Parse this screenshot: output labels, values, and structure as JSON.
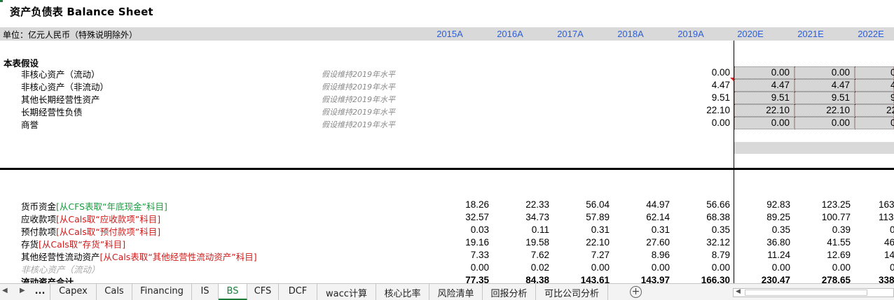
{
  "sheet": {
    "title": "资产负债表 Balance Sheet",
    "unit_label": "单位：亿元人民币（特殊说明除外）",
    "years": [
      "2015A",
      "2016A",
      "2017A",
      "2018A",
      "2019A",
      "2020E",
      "2021E",
      "2022E"
    ],
    "assumptions": {
      "heading": "本表假设",
      "rows": [
        {
          "label": "非核心资产（流动）",
          "note": "假设维持2019年水平",
          "v2019": "0.00",
          "v2020": "0.00",
          "v2021": "0.00",
          "v2022": "0"
        },
        {
          "label": "非核心资产（非流动）",
          "note": "假设维持2019年水平",
          "v2019": "4.47",
          "v2020": "4.47",
          "v2021": "4.47",
          "v2022": "4"
        },
        {
          "label": "其他长期经营性资产",
          "note": "假设维持2019年水平",
          "v2019": "9.51",
          "v2020": "9.51",
          "v2021": "9.51",
          "v2022": "9"
        },
        {
          "label": "长期经营性负债",
          "note": "假设维持2019年水平",
          "v2019": "22.10",
          "v2020": "22.10",
          "v2021": "22.10",
          "v2022": "22"
        },
        {
          "label": "商誉",
          "note": "假设维持2019年水平",
          "v2019": "0.00",
          "v2020": "0.00",
          "v2021": "0.00",
          "v2022": "0"
        }
      ]
    },
    "balance_rows": [
      {
        "label": "货币资金",
        "source": "[从CFS表取“年底现金”科目]",
        "source_color": "green",
        "values": [
          "18.26",
          "22.33",
          "56.04",
          "44.97",
          "56.66",
          "92.83",
          "123.25",
          "163"
        ]
      },
      {
        "label": "应收款项",
        "source": "[从Cals取“应收款项”科目]",
        "source_color": "red",
        "values": [
          "32.57",
          "34.73",
          "57.89",
          "62.14",
          "68.38",
          "89.25",
          "100.77",
          "113"
        ]
      },
      {
        "label": "预付款项",
        "source": "[从Cals取“预付款项”科目]",
        "source_color": "red",
        "values": [
          "0.03",
          "0.11",
          "0.31",
          "0.31",
          "0.35",
          "0.35",
          "0.39",
          "0"
        ]
      },
      {
        "label": "存货",
        "source": "[从Cals取“存货”科目]",
        "source_color": "red",
        "values": [
          "19.16",
          "19.58",
          "22.10",
          "27.60",
          "32.12",
          "36.80",
          "41.55",
          "46"
        ]
      },
      {
        "label": "其他经营性流动资产",
        "source": "[从Cals表取“其他经营性流动资产”科目]",
        "source_color": "red",
        "values": [
          "7.33",
          "7.62",
          "7.27",
          "8.96",
          "8.79",
          "11.24",
          "12.69",
          "14"
        ]
      },
      {
        "label": "非核心资产（流动）",
        "source": "",
        "source_color": "",
        "values": [
          "0.00",
          "0.02",
          "0.00",
          "0.00",
          "0.00",
          "0.00",
          "0.00",
          "0"
        ]
      },
      {
        "label": "流动资产合计",
        "source": "",
        "source_color": "",
        "values": [
          "77.35",
          "84.38",
          "143.61",
          "143.97",
          "166.30",
          "230.47",
          "278.65",
          "338"
        ]
      }
    ]
  },
  "tabs": {
    "ellipsis": "...",
    "items": [
      "Capex",
      "Cals",
      "Financing",
      "IS",
      "BS",
      "CFS",
      "DCF",
      "wacc计算",
      "核心比率",
      "风险清单",
      "回报分析",
      "可比公司分析"
    ],
    "active": "BS",
    "add_label": "+"
  },
  "colors": {
    "year_blue": "#2e5fd6",
    "source_green": "#1a9c3e",
    "source_red": "#d21919",
    "tab_active_green": "#1e7d3c",
    "assumption_fill": "#d6d6d6"
  },
  "icons": [
    "prev-sheet-icon",
    "next-sheet-icon",
    "add-sheet-icon",
    "scroll-left-icon"
  ]
}
